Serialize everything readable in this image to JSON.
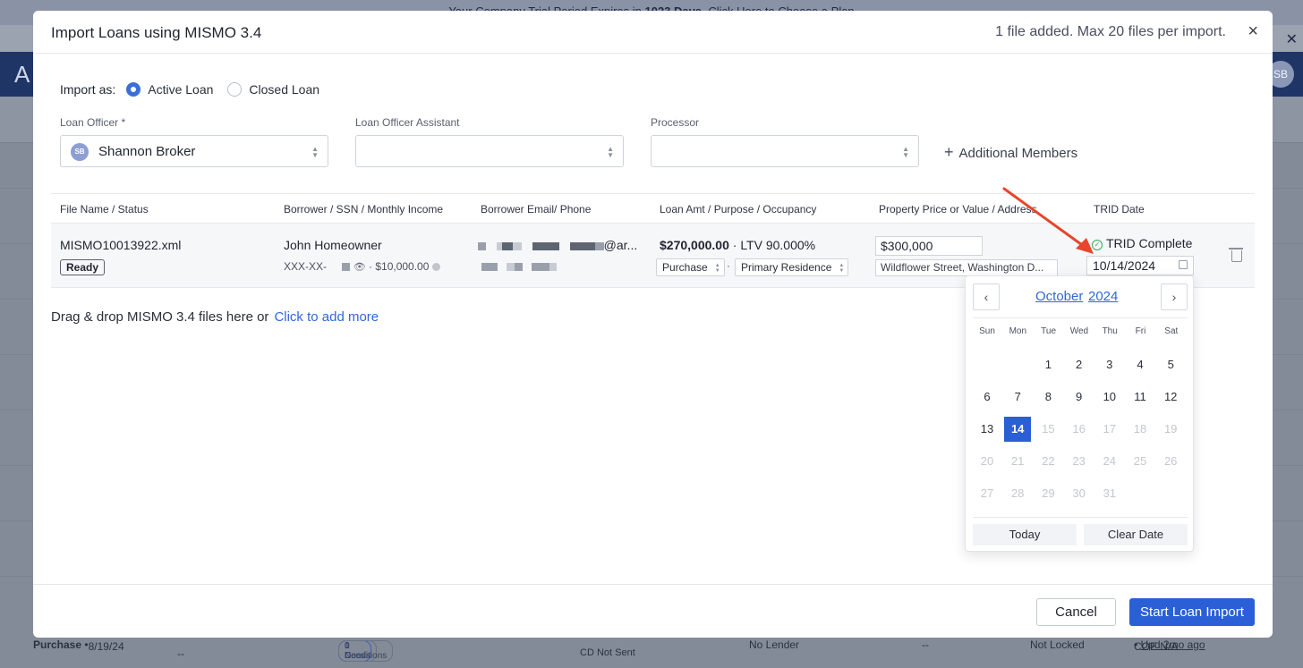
{
  "background": {
    "banner_prefix": "Your Company Trial Period Expires in ",
    "banner_days": "1023 Days",
    "banner_suffix": ". Click Here to Choose a Plan",
    "nav_logo": "A",
    "avatar_initials": "SB",
    "bottom_row": {
      "purpose": "Purchase",
      "date": "8/19/24",
      "dash1": "--",
      "needs": "0 Needs",
      "docs": "1 Docs",
      "conditions": "0 Conditions",
      "cd_status": "CD Not Sent",
      "lender": "No Lender",
      "dash2": "--",
      "lock": "Not Locked",
      "coe": "COE N/A",
      "updated": "Upd 2mo ago"
    }
  },
  "modal": {
    "title": "Import Loans using MISMO 3.4",
    "file_count": "1 file added. Max 20 files per import.",
    "close_glyph": "×",
    "import_as": {
      "label": "Import as:",
      "options": [
        {
          "label": "Active Loan",
          "selected": true
        },
        {
          "label": "Closed Loan",
          "selected": false
        }
      ]
    },
    "fields": {
      "loan_officer_label": "Loan Officer *",
      "loan_officer_value": "Shannon Broker",
      "loan_officer_initials": "SB",
      "assistant_label": "Loan Officer Assistant",
      "assistant_value": "",
      "processor_label": "Processor",
      "processor_value": "",
      "additional_members": "Additional Members"
    },
    "table": {
      "headers": [
        "File Name / Status",
        "Borrower / SSN / Monthly Income",
        "Borrower Email/ Phone",
        "Loan Amt / Purpose / Occupancy",
        "Property Price or Value / Address",
        "TRID Date"
      ],
      "row": {
        "file_name": "MISMO10013922.xml",
        "status": "Ready",
        "borrower": "John Homeowner",
        "ssn_prefix": "XXX-XX-",
        "income": "$10,000.00",
        "email_suffix": "@ar...",
        "loan_amount": "$270,000.00",
        "ltv": "LTV 90.000%",
        "purpose": "Purchase",
        "occupancy": "Primary Residence",
        "price": "$300,000",
        "address": "Wildflower Street, Washington D...",
        "trid_status": "TRID Complete",
        "trid_date": "10/14/2024"
      }
    },
    "drop_text": "Drag & drop MISMO 3.4 files here or",
    "drop_link": "Click to add more",
    "cancel_label": "Cancel",
    "start_label": "Start Loan Import"
  },
  "calendar": {
    "month": "October",
    "year": "2024",
    "weekdays": [
      "Sun",
      "Mon",
      "Tue",
      "Wed",
      "Thu",
      "Fri",
      "Sat"
    ],
    "first_weekday": 2,
    "days_in_month": 31,
    "selected_day": 14,
    "today_label": "Today",
    "clear_label": "Clear Date"
  },
  "colors": {
    "accent": "#2a5fd6",
    "link": "#2f68d8",
    "annotation_arrow": "#e8452c",
    "success": "#3aa85a"
  }
}
